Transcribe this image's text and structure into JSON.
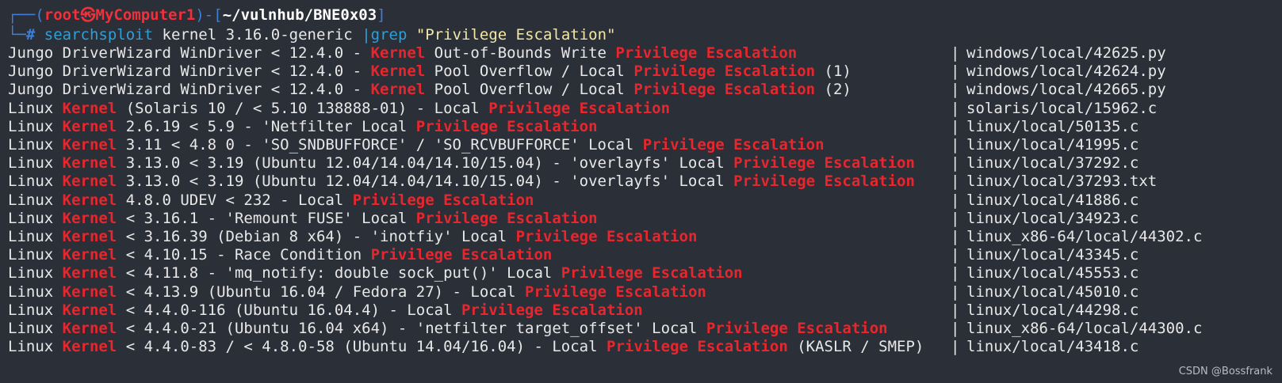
{
  "prompt": {
    "corner_top": "┌──(",
    "user": "root㉿MyComputer1",
    "mid": ")-[",
    "cwd": "~/vulnhub/BNE0x03",
    "end": "]",
    "corner_bottom": "└─",
    "hash": "#",
    "command": "searchsploit",
    "args": " kernel 3.16.0-generic ",
    "pipe": "|",
    "grep": "grep",
    "pattern": " \"Privilege Escalation\""
  },
  "results": [
    {
      "segments": [
        [
          "p",
          "Jungo DriverWizard WinDriver < 12.4.0 - "
        ],
        [
          "h",
          "Kernel"
        ],
        [
          "p",
          " Out-of-Bounds Write "
        ],
        [
          "h",
          "Privilege Escalation"
        ]
      ],
      "path": "windows/local/42625.py"
    },
    {
      "segments": [
        [
          "p",
          "Jungo DriverWizard WinDriver < 12.4.0 - "
        ],
        [
          "h",
          "Kernel"
        ],
        [
          "p",
          " Pool Overflow / Local "
        ],
        [
          "h",
          "Privilege Escalation"
        ],
        [
          "p",
          " (1)"
        ]
      ],
      "path": "windows/local/42624.py"
    },
    {
      "segments": [
        [
          "p",
          "Jungo DriverWizard WinDriver < 12.4.0 - "
        ],
        [
          "h",
          "Kernel"
        ],
        [
          "p",
          " Pool Overflow / Local "
        ],
        [
          "h",
          "Privilege Escalation"
        ],
        [
          "p",
          " (2)"
        ]
      ],
      "path": "windows/local/42665.py"
    },
    {
      "segments": [
        [
          "p",
          "Linux "
        ],
        [
          "h",
          "Kernel"
        ],
        [
          "p",
          " (Solaris 10 / < 5.10 138888-01) - Local "
        ],
        [
          "h",
          "Privilege Escalation"
        ]
      ],
      "path": "solaris/local/15962.c"
    },
    {
      "segments": [
        [
          "p",
          "Linux "
        ],
        [
          "h",
          "Kernel"
        ],
        [
          "p",
          " 2.6.19 < 5.9 - 'Netfilter Local "
        ],
        [
          "h",
          "Privilege Escalation"
        ]
      ],
      "path": "linux/local/50135.c"
    },
    {
      "segments": [
        [
          "p",
          "Linux "
        ],
        [
          "h",
          "Kernel"
        ],
        [
          "p",
          " 3.11 < 4.8 0 - 'SO_SNDBUFFORCE' / 'SO_RCVBUFFORCE' Local "
        ],
        [
          "h",
          "Privilege Escalation"
        ]
      ],
      "path": "linux/local/41995.c"
    },
    {
      "segments": [
        [
          "p",
          "Linux "
        ],
        [
          "h",
          "Kernel"
        ],
        [
          "p",
          " 3.13.0 < 3.19 (Ubuntu 12.04/14.04/14.10/15.04) - 'overlayfs' Local "
        ],
        [
          "h",
          "Privilege Escalation"
        ]
      ],
      "path": "linux/local/37292.c"
    },
    {
      "segments": [
        [
          "p",
          "Linux "
        ],
        [
          "h",
          "Kernel"
        ],
        [
          "p",
          " 3.13.0 < 3.19 (Ubuntu 12.04/14.04/14.10/15.04) - 'overlayfs' Local "
        ],
        [
          "h",
          "Privilege Escalation"
        ]
      ],
      "path": "linux/local/37293.txt"
    },
    {
      "segments": [
        [
          "p",
          "Linux "
        ],
        [
          "h",
          "Kernel"
        ],
        [
          "p",
          " 4.8.0 UDEV < 232 - Local "
        ],
        [
          "h",
          "Privilege Escalation"
        ]
      ],
      "path": "linux/local/41886.c"
    },
    {
      "segments": [
        [
          "p",
          "Linux "
        ],
        [
          "h",
          "Kernel"
        ],
        [
          "p",
          " < 3.16.1 - 'Remount FUSE' Local "
        ],
        [
          "h",
          "Privilege Escalation"
        ]
      ],
      "path": "linux/local/34923.c"
    },
    {
      "segments": [
        [
          "p",
          "Linux "
        ],
        [
          "h",
          "Kernel"
        ],
        [
          "p",
          " < 3.16.39 (Debian 8 x64) - 'inotfiy' Local "
        ],
        [
          "h",
          "Privilege Escalation"
        ]
      ],
      "path": "linux_x86-64/local/44302.c"
    },
    {
      "segments": [
        [
          "p",
          "Linux "
        ],
        [
          "h",
          "Kernel"
        ],
        [
          "p",
          " < 4.10.15 - Race Condition "
        ],
        [
          "h",
          "Privilege Escalation"
        ]
      ],
      "path": "linux/local/43345.c"
    },
    {
      "segments": [
        [
          "p",
          "Linux "
        ],
        [
          "h",
          "Kernel"
        ],
        [
          "p",
          " < 4.11.8 - 'mq_notify: double sock_put()' Local "
        ],
        [
          "h",
          "Privilege Escalation"
        ]
      ],
      "path": "linux/local/45553.c"
    },
    {
      "segments": [
        [
          "p",
          "Linux "
        ],
        [
          "h",
          "Kernel"
        ],
        [
          "p",
          " < 4.13.9 (Ubuntu 16.04 / Fedora 27) - Local "
        ],
        [
          "h",
          "Privilege Escalation"
        ]
      ],
      "path": "linux/local/45010.c"
    },
    {
      "segments": [
        [
          "p",
          "Linux "
        ],
        [
          "h",
          "Kernel"
        ],
        [
          "p",
          " < 4.4.0-116 (Ubuntu 16.04.4) - Local "
        ],
        [
          "h",
          "Privilege Escalation"
        ]
      ],
      "path": "linux/local/44298.c"
    },
    {
      "segments": [
        [
          "p",
          "Linux "
        ],
        [
          "h",
          "Kernel"
        ],
        [
          "p",
          " < 4.4.0-21 (Ubuntu 16.04 x64) - 'netfilter target_offset' Local "
        ],
        [
          "h",
          "Privilege Escalation"
        ]
      ],
      "path": "linux_x86-64/local/44300.c"
    },
    {
      "segments": [
        [
          "p",
          "Linux "
        ],
        [
          "h",
          "Kernel"
        ],
        [
          "p",
          " < 4.4.0-83 / < 4.8.0-58 (Ubuntu 14.04/16.04) - Local "
        ],
        [
          "h",
          "Privilege Escalation"
        ],
        [
          "p",
          " (KASLR / SMEP)"
        ]
      ],
      "path": "linux/local/43418.c"
    }
  ],
  "separator": "|",
  "watermark": "CSDN @Bossfrank",
  "colors": {
    "background": "#2b2f38",
    "highlight": "#e8262d",
    "prompt_blue": "#3d7fdc",
    "user_red": "#f0303a",
    "command_cyan": "#2f9fd6",
    "string_yellow": "#f3e7a8"
  }
}
